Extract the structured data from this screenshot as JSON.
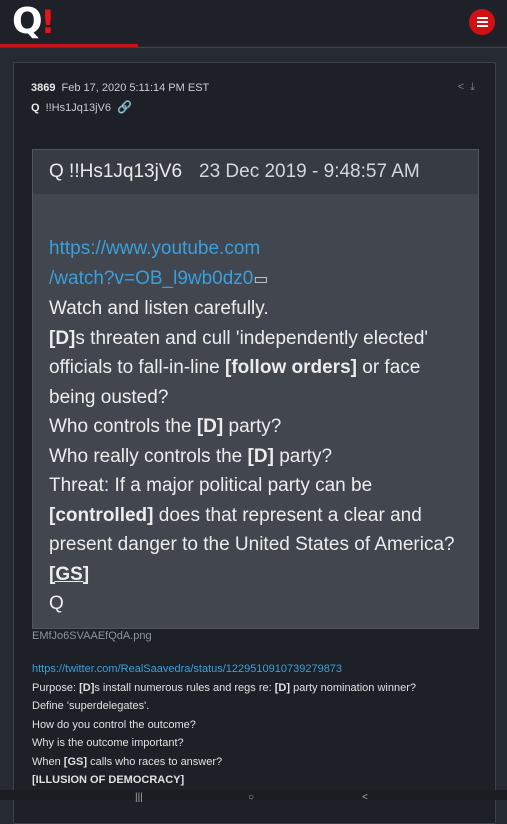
{
  "app": {
    "logo": "Q",
    "logo_bang": "!",
    "menu_icon": "hamburger-icon"
  },
  "post": {
    "number": "3869",
    "date": "Feb 17, 2020 5:11:14 PM EST",
    "author": "Q",
    "tripcode": "!!Hs1Jq13jV6",
    "actions": [
      "share-icon",
      "download-icon"
    ],
    "quote": {
      "author": "Q  !!Hs1Jq13jV6",
      "date": "23 Dec 2019 - 9:48:57 AM",
      "link_line1": "https://www.youtube.com",
      "link_line2": "/watch?v=OB_l9wb0dz0",
      "line_watch": "Watch and listen carefully.",
      "d_tag": "[D]",
      "line_threaten": "s threaten and cull 'independently elected'",
      "line_officials": "officials to fall-in-line ",
      "follow_orders": "[follow orders]",
      "line_or_face": " or face",
      "line_ousted": "being ousted?",
      "line_who_controls": "Who controls the ",
      "party_suffix": " party?",
      "line_who_really": "Who really controls the ",
      "line_threat": "Threat: If a major political party can be",
      "controlled_tag": "[controlled]",
      "line_represent": " does that represent a clear and",
      "line_present": "present danger to the United States of America?",
      "gs_tag": "[GS]",
      "signoff": "Q"
    },
    "filename": "EMfJo6SVAAEfQdA.png",
    "twitter_link": "https://twitter.com/RealSaavedra/status/1229510910739279873",
    "purpose_prefix": "Purpose: ",
    "d_tag": "[D]",
    "purpose_mid": "s install numerous rules and regs re: ",
    "purpose_end": " party nomination winner?",
    "define": "Define 'superdelegates'.",
    "control": "How do you control the outcome?",
    "important": "Why is the outcome important?",
    "when_prefix": "When ",
    "gs_tag": "[GS]",
    "when_suffix": " calls who races to answer?",
    "illusion": "[ILLUSION OF DEMOCRACY]"
  }
}
